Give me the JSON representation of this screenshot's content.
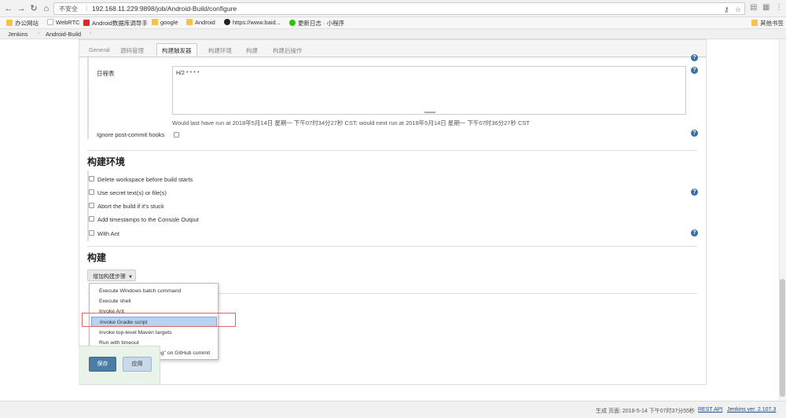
{
  "browser": {
    "security_label": "不安全",
    "url": "192.168.11.229:9898/job/Android-Build/configure",
    "bookmarks": [
      {
        "label": "办公网站",
        "icon": "folder-icon"
      },
      {
        "label": "WebRTC",
        "icon": "page-icon"
      },
      {
        "label": "Android数据库调导手",
        "icon": "red-c-icon"
      },
      {
        "label": "google",
        "icon": "folder-icon"
      },
      {
        "label": "Android",
        "icon": "folder-icon"
      },
      {
        "label": "https://www.baid...",
        "icon": "github-icon"
      },
      {
        "label": "更新日志 · 小程序",
        "icon": "wechat-icon"
      }
    ],
    "other_bookmarks": "其他书签"
  },
  "breadcrumb": {
    "root": "Jenkins",
    "job": "Android-Build"
  },
  "tabs": [
    {
      "label": "General"
    },
    {
      "label": "源码管理"
    },
    {
      "label": "构建触发器"
    },
    {
      "label": "构建环境"
    },
    {
      "label": "构建"
    },
    {
      "label": "构建后操作"
    }
  ],
  "triggers": {
    "schedule_label": "日程表",
    "schedule_value": "H/2 * * * *",
    "schedule_note": "Would last have run at 2018年5月14日 星期一 下午07时34分27秒 CST; would next run at 2018年5月14日 星期一 下午07时36分27秒 CST",
    "ignore_hooks_label": "Ignore post-commit hooks"
  },
  "build_env": {
    "title": "构建环境",
    "options": [
      "Delete workspace before build starts",
      "Use secret text(s) or file(s)",
      "Abort the build if it's stuck",
      "Add timestamps to the Console Output",
      "With Ant"
    ]
  },
  "build": {
    "title": "构建",
    "add_step_label": "增加构建步骤",
    "menu_items": [
      "Execute Windows batch command",
      "Execute shell",
      "Invoke Ant",
      "Invoke Gradle script",
      "Invoke top-level Maven targets",
      "Run with timeout",
      "Set build status to \"pending\" on GitHub commit"
    ],
    "highlighted_item": "Invoke Gradle script"
  },
  "buttons": {
    "save": "保存",
    "apply": "应用"
  },
  "footer": {
    "generated": "生成 页面: 2018-5-14 下午07时37分55秒",
    "rest_api": "REST API",
    "version": "Jenkins ver. 2.107.3"
  },
  "help_symbol": "?"
}
